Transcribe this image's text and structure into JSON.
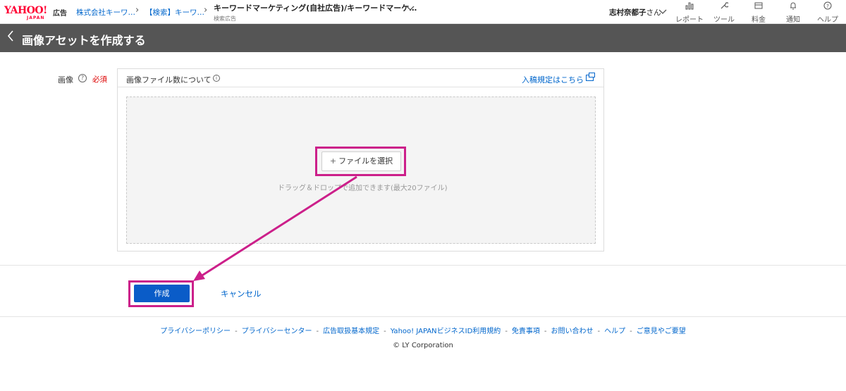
{
  "header": {
    "logo_main": "YAHOO!",
    "logo_sub": "JAPAN",
    "logo_ads": "広告",
    "breadcrumbs": [
      "株式会社キーワ…",
      "【検索】キーワ…"
    ],
    "campaign_name": "キーワードマーケティング(自社広告)/キーワードマーケ…",
    "campaign_type": "検索広告",
    "user_name": "志村奈都子",
    "user_suffix": "さん",
    "nav": [
      {
        "label": "レポート",
        "icon": "chart-icon"
      },
      {
        "label": "ツール",
        "icon": "wrench-icon"
      },
      {
        "label": "料金",
        "icon": "wallet-icon"
      },
      {
        "label": "通知",
        "icon": "bell-icon"
      },
      {
        "label": "ヘルプ",
        "icon": "help-icon"
      }
    ]
  },
  "title_bar": {
    "title": "画像アセットを作成する"
  },
  "form": {
    "image_label": "画像",
    "required_label": "必須",
    "panel_title": "画像ファイル数について",
    "rules_link": "入稿規定はこちら",
    "file_button": "ファイルを選択",
    "drop_hint": "ドラッグ＆ドロップで追加できます(最大20ファイル)",
    "create_button": "作成",
    "cancel_link": "キャンセル"
  },
  "footer": {
    "links": [
      "プライバシーポリシー",
      "プライバシーセンター",
      "広告取扱基本規定",
      "Yahoo! JAPANビジネスID利用規約",
      "免責事項",
      "お問い合わせ",
      "ヘルプ",
      "ご意見やご要望"
    ],
    "copyright": "© LY Corporation"
  },
  "colors": {
    "accent_blue": "#0a5cc8",
    "link_blue": "#0066cc",
    "highlight_magenta": "#cc1f8a",
    "title_bar_gray": "#555555",
    "brand_red": "#ff0033"
  }
}
